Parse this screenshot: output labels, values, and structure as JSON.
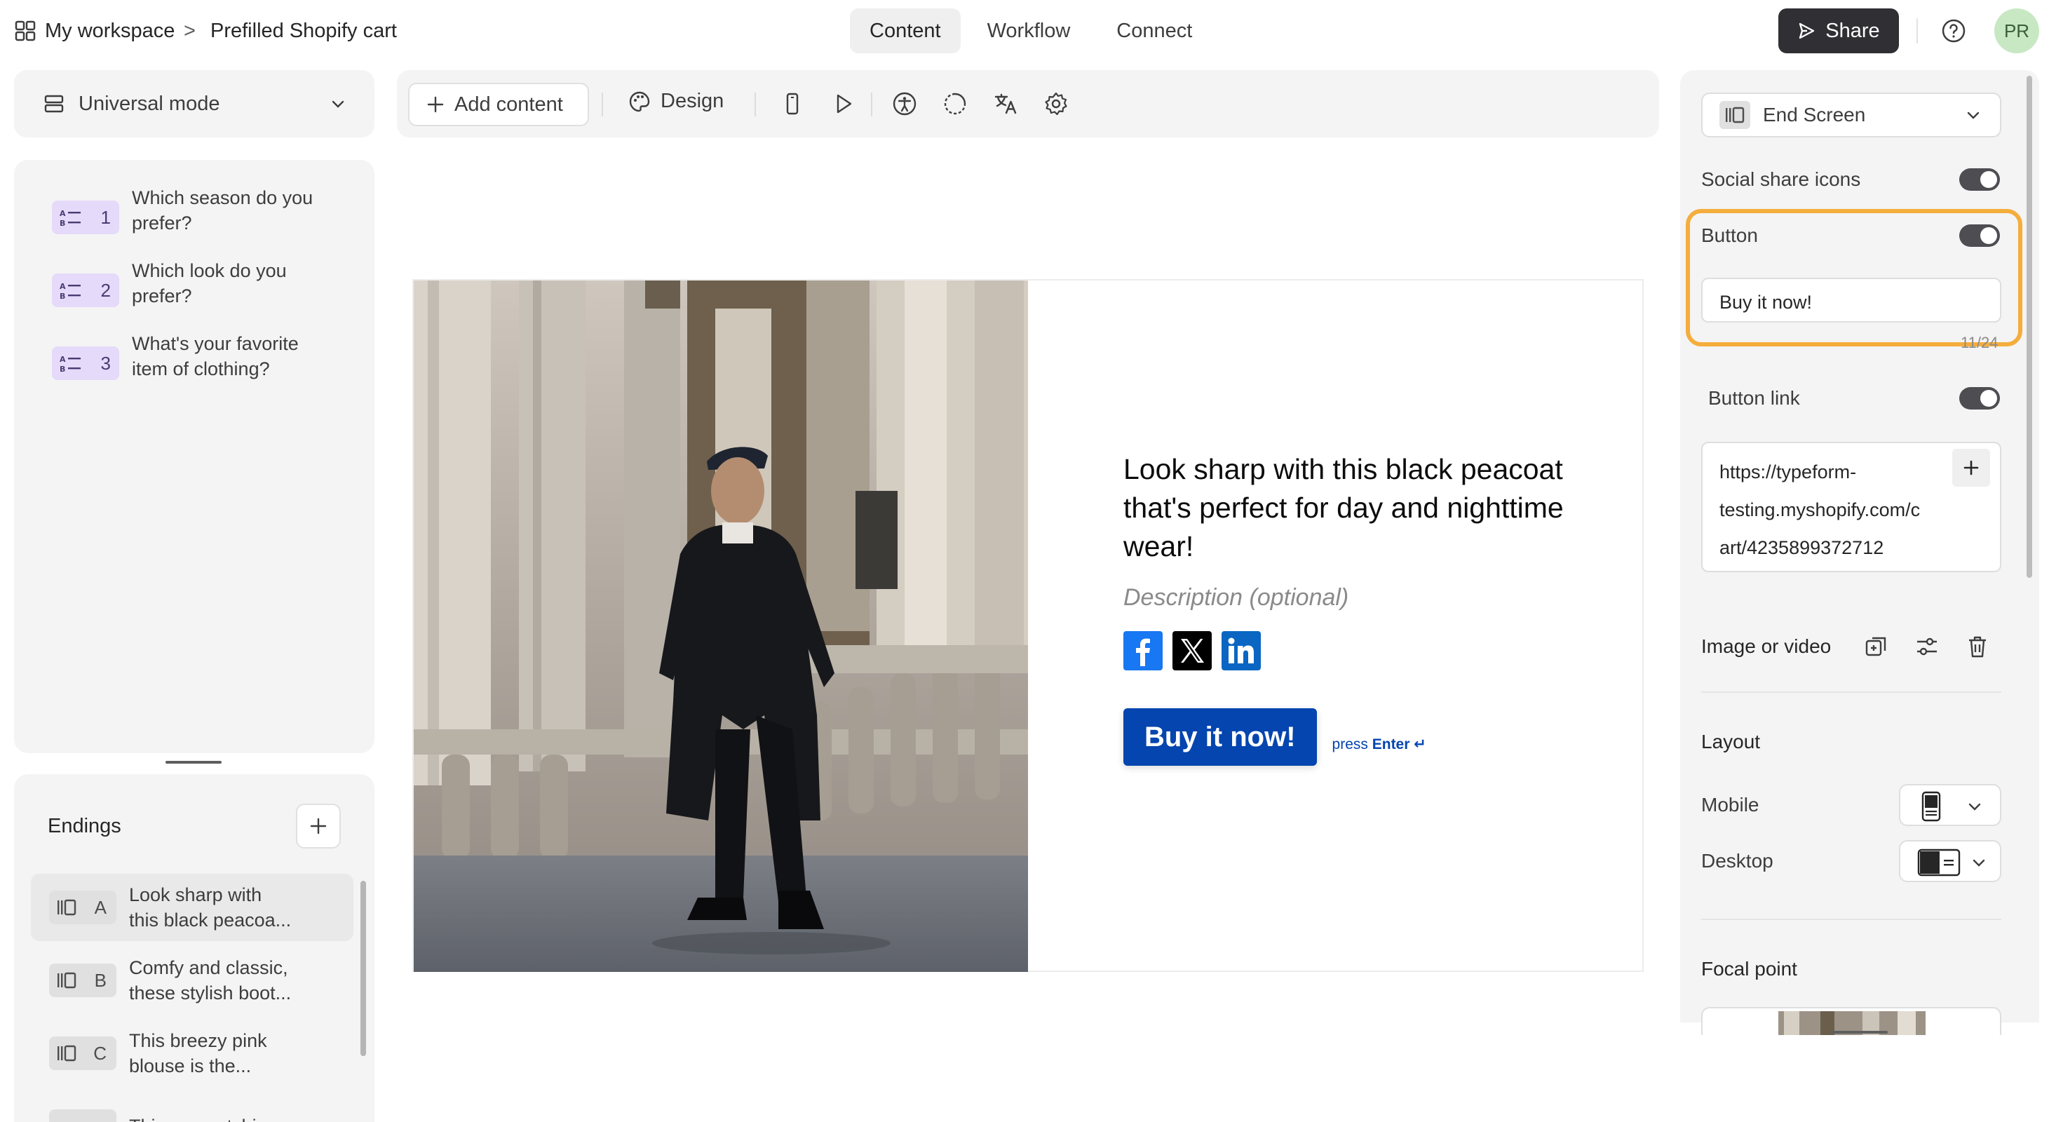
{
  "topbar": {
    "workspace": "My workspace",
    "separator": ">",
    "form_name": "Prefilled Shopify cart",
    "tabs": [
      {
        "label": "Content",
        "active": true
      },
      {
        "label": "Workflow",
        "active": false
      },
      {
        "label": "Connect",
        "active": false
      }
    ],
    "share_label": "Share",
    "avatar_initials": "PR"
  },
  "sidebar": {
    "mode_label": "Universal mode",
    "questions": [
      {
        "number": "1",
        "text_lines": [
          "Which season do you",
          "prefer?"
        ]
      },
      {
        "number": "2",
        "text_lines": [
          "Which look do you",
          "prefer?"
        ]
      },
      {
        "number": "3",
        "text_lines": [
          "What's your favorite",
          "item of clothing?"
        ]
      }
    ],
    "endings_title": "Endings",
    "endings": [
      {
        "letter": "A",
        "text_lines": [
          "Look sharp with",
          "this black peacoa..."
        ],
        "active": true
      },
      {
        "letter": "B",
        "text_lines": [
          "Comfy and classic,",
          "these stylish boot..."
        ],
        "active": false
      },
      {
        "letter": "C",
        "text_lines": [
          "This breezy pink",
          "blouse is the..."
        ],
        "active": false
      },
      {
        "letter": "",
        "text_lines": [
          "This eye-catching"
        ],
        "active": false
      }
    ]
  },
  "toolbar": {
    "add_content_label": "Add content",
    "design_label": "Design"
  },
  "canvas": {
    "heading": "Look sharp with this black peacoat that's perfect for day and nighttime wear!",
    "description_placeholder": "Description (optional)",
    "button_label": "Buy it now!",
    "press_hint": "press",
    "press_key": "Enter ↵"
  },
  "settings": {
    "screen_type": "End Screen",
    "social_share_label": "Social share icons",
    "social_share_on": true,
    "button_label": "Button",
    "button_on": true,
    "button_text": "Buy it now!",
    "button_counter": "11/24",
    "button_link_label": "Button link",
    "button_link_on": true,
    "button_link_lines": [
      "https://typeform-",
      "testing.myshopify.com/c",
      "art/4235899372712"
    ],
    "image_video_label": "Image or video",
    "layout_title": "Layout",
    "mobile_label": "Mobile",
    "desktop_label": "Desktop",
    "focal_point_title": "Focal point"
  },
  "colors": {
    "accent_highlight": "#f5ad3c",
    "button_blue": "#0445af",
    "question_badge": "#e5dafa",
    "share_button": "#2f2f34"
  }
}
